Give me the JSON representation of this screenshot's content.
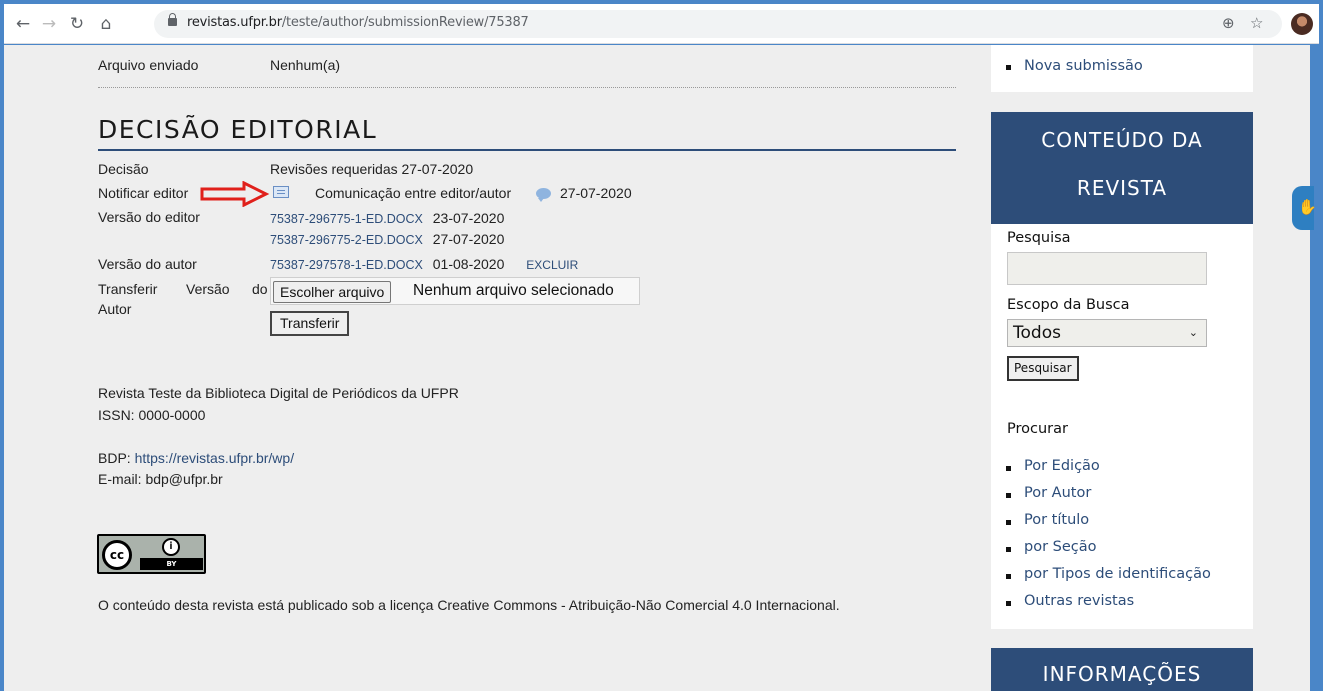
{
  "browser": {
    "url_host": "revistas.ufpr.br",
    "url_path": "/teste/author/submissionReview/75387"
  },
  "top": {
    "arquivo_label": "Arquivo enviado",
    "arquivo_value": "Nenhum(a)"
  },
  "decision": {
    "heading": "DECISÃO EDITORIAL",
    "decisao_label": "Decisão",
    "decisao_value": "Revisões requeridas 27-07-2020",
    "notificar_label": "Notificar editor",
    "comunicacao_text": "Comunicação entre editor/autor",
    "comunicacao_date": "27-07-2020",
    "versao_editor_label": "Versão do editor",
    "editor_files": [
      {
        "name": "75387-296775-1-ED.DOCX",
        "date": "23-07-2020"
      },
      {
        "name": "75387-296775-2-ED.DOCX",
        "date": "27-07-2020"
      }
    ],
    "versao_autor_label": "Versão do autor",
    "author_file": {
      "name": "75387-297578-1-ED.DOCX",
      "date": "01-08-2020",
      "action": "EXCLUIR"
    },
    "transferir_label_1": "Transferir",
    "transferir_label_2": "Versão",
    "transferir_label_3": "do",
    "transferir_label_4": "Autor",
    "choose_file_btn": "Escolher arquivo",
    "no_file_text": "Nenhum arquivo selecionado",
    "transfer_btn": "Transferir"
  },
  "footer": {
    "line1": "Revista Teste da Biblioteca Digital de Periódicos da UFPR",
    "line2": "ISSN: 0000-0000",
    "bdp_label": "BDP:",
    "bdp_link": "https://revistas.ufpr.br/wp/",
    "email": "E-mail: bdp@ufpr.br",
    "cc_logo": "cc",
    "cc_by": "BY",
    "license": "O conteúdo desta revista está publicado sob a licença Creative Commons - Atribuição-Não Comercial 4.0 Internacional."
  },
  "sidebar": {
    "nova_submissao": "Nova submissão",
    "content_title_1": "CONTEÚDO DA",
    "content_title_2": "REVISTA",
    "pesquisa_label": "Pesquisa",
    "search_placeholder": "",
    "escopo_label": "Escopo da Busca",
    "escopo_value": "Todos",
    "search_btn": "Pesquisar",
    "procurar_label": "Procurar",
    "browse_items": [
      "Por Edição",
      "Por Autor",
      "Por título",
      "por Seção",
      "por Tipos de identificação",
      "Outras revistas"
    ],
    "info_title": "INFORMAÇÕES"
  }
}
